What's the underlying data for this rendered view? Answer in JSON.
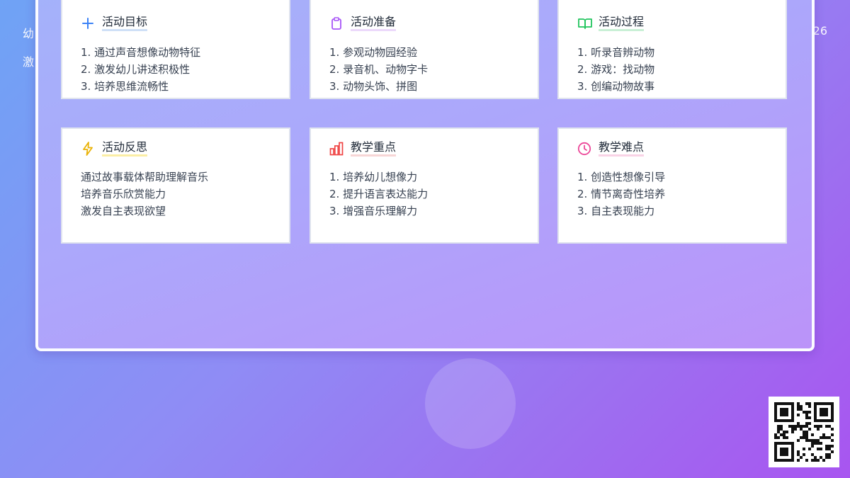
{
  "background": {
    "left_line1": "幼",
    "left_line2": "激",
    "right_text": "26"
  },
  "colors": {
    "goal": "#3b82f6",
    "prep": "#a855f7",
    "process": "#22c55e",
    "reflect": "#eab308",
    "key": "#ef4444",
    "difficulty": "#ec4899"
  },
  "cards": [
    {
      "title": "活动目标",
      "icon": "plus-icon",
      "items": [
        "1. 通过声音想像动物特征",
        "2. 激发幼儿讲述积极性",
        "3. 培养思维流畅性"
      ]
    },
    {
      "title": "活动准备",
      "icon": "clipboard-icon",
      "items": [
        "1. 参观动物园经验",
        "2. 录音机、动物字卡",
        "3. 动物头饰、拼图"
      ]
    },
    {
      "title": "活动过程",
      "icon": "book-open-icon",
      "items": [
        "1. 听录音辨动物",
        "2. 游戏：找动物",
        "3. 创编动物故事"
      ]
    },
    {
      "title": "活动反思",
      "icon": "lightning-icon",
      "items": [
        "通过故事载体帮助理解音乐",
        "培养音乐欣赏能力",
        "激发自主表现欲望"
      ]
    },
    {
      "title": "教学重点",
      "icon": "bar-chart-icon",
      "items": [
        "1. 培养幼儿想像力",
        "2. 提升语言表达能力",
        "3. 增强音乐理解力"
      ]
    },
    {
      "title": "教学难点",
      "icon": "clock-icon",
      "items": [
        "1. 创造性想像引导",
        "2. 情节离奇性培养",
        "3. 自主表现能力"
      ]
    }
  ]
}
